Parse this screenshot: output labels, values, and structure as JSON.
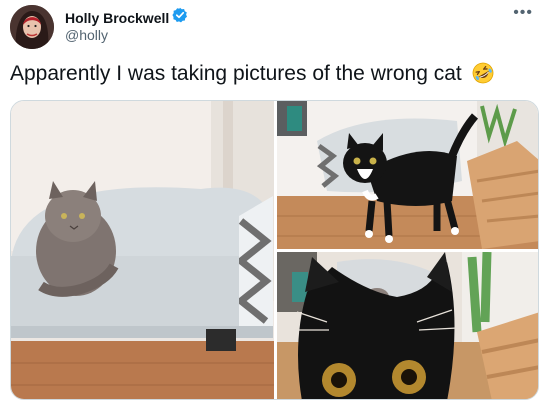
{
  "tweet": {
    "author_name": "Holly Brockwell",
    "handle": "@holly",
    "text": "Apparently I was taking pictures of the wrong cat",
    "emoji": "rolling-on-floor-laughing-emoji"
  },
  "media": {
    "photos": [
      {
        "subject": "grey-cat-on-sofa"
      },
      {
        "subject": "black-white-cat-standing"
      },
      {
        "subject": "black-cat-closeup"
      }
    ]
  },
  "colors": {
    "verified": "#1d9bf0",
    "text": "#0f1419",
    "secondary": "#536471"
  }
}
